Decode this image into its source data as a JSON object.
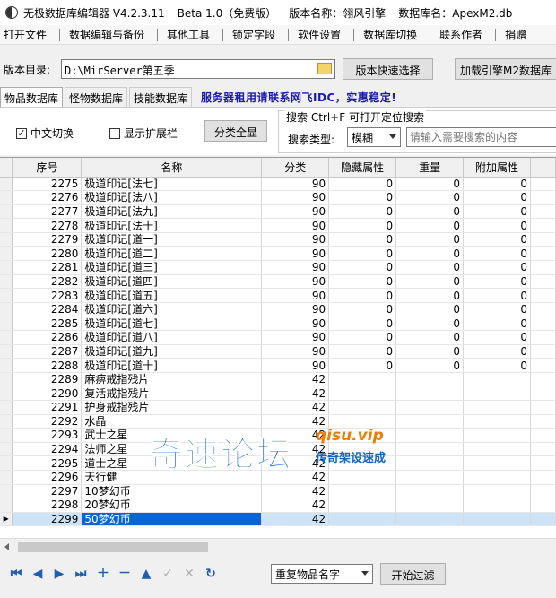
{
  "window": {
    "title": "无极数据库编辑器 V4.2.3.11",
    "edition": "Beta 1.0（免费版）",
    "version_name": "版本名称：翎风引擎",
    "db_name": "数据库名：ApexM2.db"
  },
  "menu": [
    "打开文件",
    "数据编辑与备份",
    "其他工具",
    "锁定字段",
    "软件设置",
    "数据库切换",
    "联系作者",
    "捐赠"
  ],
  "dirbar": {
    "label": "版本目录:",
    "path": "D:\\MirServer第五季",
    "quick_select": "版本快速选择",
    "load_engine": "加载引擎M2数据库"
  },
  "tabs": [
    "物品数据库",
    "怪物数据库",
    "技能数据库"
  ],
  "promo": "服务器租用请联系网飞IDC，实惠稳定!",
  "options": {
    "chinese_switch": "中文切换",
    "chinese_switch_checked": true,
    "show_ext": "显示扩展栏",
    "show_ext_checked": false,
    "show_all": "分类全显"
  },
  "search": {
    "legend": "搜索  Ctrl+F 可打开定位搜索",
    "type_label": "搜索类型:",
    "type_value": "模糊",
    "placeholder": "请输入需要搜索的内容"
  },
  "table": {
    "columns": [
      "序号",
      "名称",
      "分类",
      "隐藏属性",
      "重量",
      "附加属性"
    ],
    "rows": [
      [
        "2275",
        "极道印记[法七]",
        "90",
        "0",
        "0",
        "0"
      ],
      [
        "2276",
        "极道印记[法八]",
        "90",
        "0",
        "0",
        "0"
      ],
      [
        "2277",
        "极道印记[法九]",
        "90",
        "0",
        "0",
        "0"
      ],
      [
        "2278",
        "极道印记[法十]",
        "90",
        "0",
        "0",
        "0"
      ],
      [
        "2279",
        "极道印记[道一]",
        "90",
        "0",
        "0",
        "0"
      ],
      [
        "2280",
        "极道印记[道二]",
        "90",
        "0",
        "0",
        "0"
      ],
      [
        "2281",
        "极道印记[道三]",
        "90",
        "0",
        "0",
        "0"
      ],
      [
        "2282",
        "极道印记[道四]",
        "90",
        "0",
        "0",
        "0"
      ],
      [
        "2283",
        "极道印记[道五]",
        "90",
        "0",
        "0",
        "0"
      ],
      [
        "2284",
        "极道印记[道六]",
        "90",
        "0",
        "0",
        "0"
      ],
      [
        "2285",
        "极道印记[道七]",
        "90",
        "0",
        "0",
        "0"
      ],
      [
        "2286",
        "极道印记[道八]",
        "90",
        "0",
        "0",
        "0"
      ],
      [
        "2287",
        "极道印记[道九]",
        "90",
        "0",
        "0",
        "0"
      ],
      [
        "2288",
        "极道印记[道十]",
        "90",
        "0",
        "0",
        "0"
      ],
      [
        "2289",
        "麻痹戒指残片",
        "42",
        "",
        "",
        ""
      ],
      [
        "2290",
        "复活戒指残片",
        "42",
        "",
        "",
        ""
      ],
      [
        "2291",
        "护身戒指残片",
        "42",
        "",
        "",
        ""
      ],
      [
        "2292",
        "水晶",
        "42",
        "",
        "",
        ""
      ],
      [
        "2293",
        "武士之星",
        "42",
        "",
        "",
        ""
      ],
      [
        "2294",
        "法师之星",
        "42",
        "",
        "",
        ""
      ],
      [
        "2295",
        "道士之星",
        "42",
        "",
        "",
        ""
      ],
      [
        "2296",
        "天行健",
        "42",
        "",
        "",
        ""
      ],
      [
        "2297",
        "10梦幻币",
        "42",
        "",
        "",
        ""
      ],
      [
        "2298",
        "20梦幻币",
        "42",
        "",
        "",
        ""
      ],
      [
        "2299",
        "50梦幻币",
        "42",
        "",
        "",
        ""
      ]
    ],
    "selected_index": 24
  },
  "footer": {
    "dup_select": "重复物品名字",
    "filter_button": "开始过滤"
  },
  "watermark": {
    "main": "奇速论坛",
    "url": "qisu.vip",
    "sub": "传奇架设速成"
  }
}
